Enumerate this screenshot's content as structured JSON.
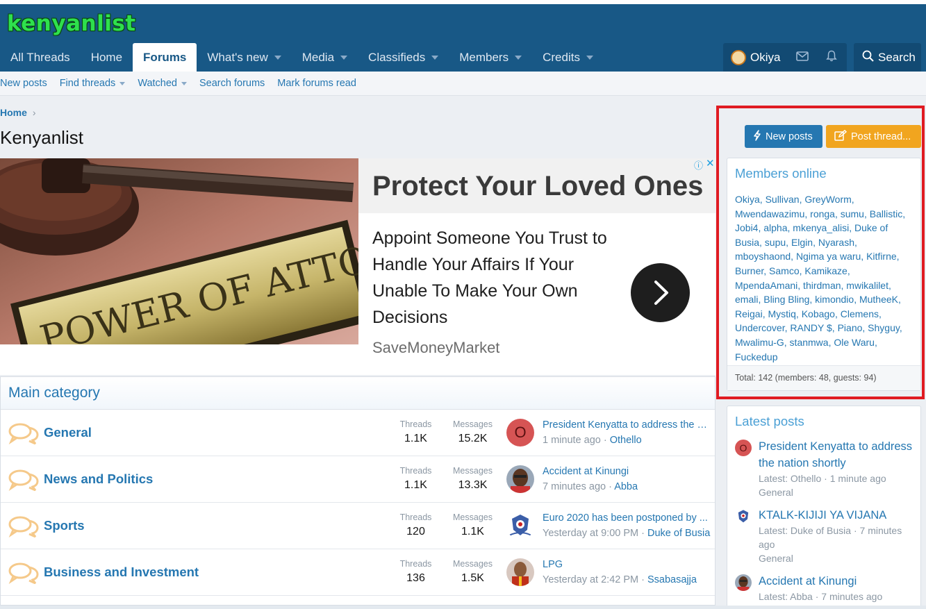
{
  "header": {
    "logo": "kenyanlist",
    "tabs": [
      {
        "label": "All Threads",
        "caret": false,
        "active": false
      },
      {
        "label": "Home",
        "caret": false,
        "active": false
      },
      {
        "label": "Forums",
        "caret": false,
        "active": true
      },
      {
        "label": "What's new",
        "caret": true,
        "active": false
      },
      {
        "label": "Media",
        "caret": true,
        "active": false
      },
      {
        "label": "Classifieds",
        "caret": true,
        "active": false
      },
      {
        "label": "Members",
        "caret": true,
        "active": false
      },
      {
        "label": "Credits",
        "caret": true,
        "active": false
      }
    ],
    "user": "Okiya",
    "search_label": "Search"
  },
  "subnav": [
    {
      "label": "New posts",
      "caret": false
    },
    {
      "label": "Find threads",
      "caret": true
    },
    {
      "label": "Watched",
      "caret": true
    },
    {
      "label": "Search forums",
      "caret": false
    },
    {
      "label": "Mark forums read",
      "caret": false
    }
  ],
  "breadcrumb": {
    "home": "Home",
    "sep": "›"
  },
  "page_title": "Kenyanlist",
  "ad": {
    "image_text": "POWER OF ATTORNEY",
    "headline": "Protect Your Loved Ones",
    "body": "Appoint Someone You Trust to Handle Your Affairs If Your Unable To Make Your Own Decisions",
    "source": "SaveMoneyMarket",
    "info_icon": "ⓘ",
    "close_icon": "✕"
  },
  "category": {
    "title": "Main category",
    "threads_label": "Threads",
    "messages_label": "Messages",
    "forums": [
      {
        "title": "General",
        "threads": "1.1K",
        "messages": "15.2K",
        "last_title": "President Kenyatta to address the n...",
        "last_time": "1 minute ago",
        "last_user": "Othello",
        "avatar": "letter",
        "avatar_letter": "O"
      },
      {
        "title": "News and Politics",
        "threads": "1.1K",
        "messages": "13.3K",
        "last_title": "Accident at Kinungi",
        "last_time": "7 minutes ago",
        "last_user": "Abba",
        "avatar": "face"
      },
      {
        "title": "Sports",
        "threads": "120",
        "messages": "1.1K",
        "last_title": "Euro 2020 has been postponed by ...",
        "last_time": "Yesterday at 9:00 PM",
        "last_user": "Duke of Busia",
        "avatar": "crest"
      },
      {
        "title": "Business and Investment",
        "threads": "136",
        "messages": "1.5K",
        "last_title": "LPG",
        "last_time": "Yesterday at 2:42 PM",
        "last_user": "Ssabasajja",
        "avatar": "red"
      }
    ]
  },
  "sidebar": {
    "new_posts_label": "New posts",
    "post_thread_label": "Post thread...",
    "members_online": {
      "title": "Members online",
      "members_text": "Okiya, Sullivan, GreyWorm, Mwendawazimu, ronga, sumu, Ballistic, Jobi4, alpha, mkenya_alisi, Duke of Busia, supu, Elgin, Nyarash, mboyshaond, Ngima ya waru, Kitfirne, Burner, Samco, Kamikaze, MpendaAmani, thirdman, mwikalilet, emali, Bling Bling, kimondio, MutheeK, Reigai, Mystiq, Kobago, Clemens, Undercover, RANDY $, Piano, Shyguy, Mwalimu-G, stanmwa, Ole Waru, Fuckedup",
      "total": "Total: 142 (members: 48, guests: 94)"
    },
    "latest_posts": {
      "title": "Latest posts",
      "items": [
        {
          "title": "President Kenyatta to address the nation shortly",
          "meta": "Latest: Othello · 1 minute ago",
          "forum": "General",
          "avatar": "letter",
          "avatar_letter": "O"
        },
        {
          "title": "KTALK-KIJIJI YA VIJANA",
          "meta": "Latest: Duke of Busia · 7 minutes ago",
          "forum": "General",
          "avatar": "crest"
        },
        {
          "title": "Accident at Kinungi",
          "meta": "Latest: Abba · 7 minutes ago",
          "forum": "",
          "avatar": "face"
        }
      ]
    }
  },
  "colors": {
    "header_bg": "#185886",
    "link_blue": "#2577b1",
    "accent_orange": "#f1a51f",
    "highlight_red": "#e01b22"
  }
}
